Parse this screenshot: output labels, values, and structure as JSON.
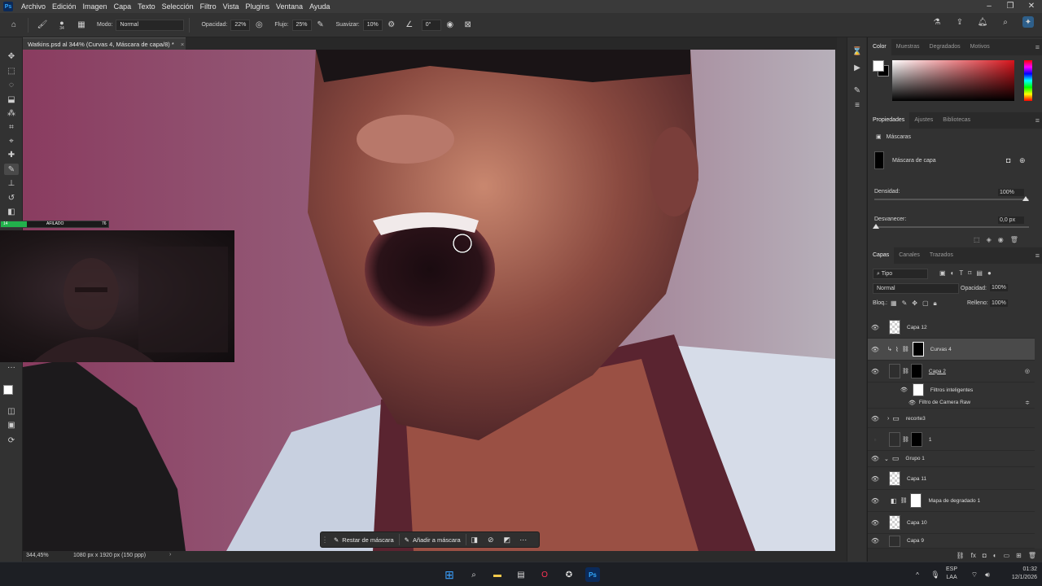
{
  "menubar": {
    "items": [
      "Archivo",
      "Edición",
      "Imagen",
      "Capa",
      "Texto",
      "Selección",
      "Filtro",
      "Vista",
      "Plugins",
      "Ventana",
      "Ayuda"
    ]
  },
  "options": {
    "brush_size": "34",
    "mode_label": "Modo:",
    "mode_value": "Normal",
    "opacity_label": "Opacidad:",
    "opacity_value": "22%",
    "flow_label": "Flujo:",
    "flow_value": "25%",
    "smooth_label": "Suavizar:",
    "smooth_value": "10%",
    "angle_value": "0°"
  },
  "document": {
    "tab_title": "Watkins.psd al 344% (Curvas 4, Máscara de capa/8) *"
  },
  "status": {
    "zoom": "344,45%",
    "doc_size": "1080 px x 1920 px (150 ppp)"
  },
  "context_bar": {
    "subtract_label": "Restar de máscara",
    "add_label": "Añadir a máscara"
  },
  "webcam_bar": {
    "left": "14",
    "label": "AFILADO",
    "right": "76"
  },
  "color_panel": {
    "tabs": [
      "Color",
      "Muestras",
      "Degradados",
      "Motivos"
    ]
  },
  "properties_panel": {
    "tabs": [
      "Propiedades",
      "Ajustes",
      "Bibliotecas"
    ],
    "masks_label": "Máscaras",
    "layer_mask_label": "Máscara de capa",
    "density_label": "Densidad:",
    "density_value": "100%",
    "feather_label": "Desvanecer:",
    "feather_value": "0,0 px"
  },
  "layers_panel": {
    "tabs": [
      "Capas",
      "Canales",
      "Trazados"
    ],
    "filter_kind": "Tipo",
    "blend_mode": "Normal",
    "opacity_label": "Opacidad:",
    "opacity_value": "100%",
    "lock_label": "Bloq.:",
    "fill_label": "Relleno:",
    "fill_value": "100%",
    "layers": [
      {
        "name": "Capa 12"
      },
      {
        "name": "Curvas 4"
      },
      {
        "name": "Capa 2"
      },
      {
        "name": "Filtros inteligentes"
      },
      {
        "name": "Filtro de Camera Raw"
      },
      {
        "name": "recorte3"
      },
      {
        "name": "1"
      },
      {
        "name": "Grupo 1"
      },
      {
        "name": "Capa 11"
      },
      {
        "name": "Mapa de degradado 1"
      },
      {
        "name": "Capa 10"
      },
      {
        "name": "Capa 9"
      }
    ]
  },
  "taskbar": {
    "lang_top": "ESP",
    "lang_bottom": "LAA",
    "time": "01:32",
    "date": "12/1/2026"
  },
  "colors": {
    "accent": "#31a8ff",
    "canvas_bg": "#7a3a58",
    "panel_bg": "#323232"
  }
}
